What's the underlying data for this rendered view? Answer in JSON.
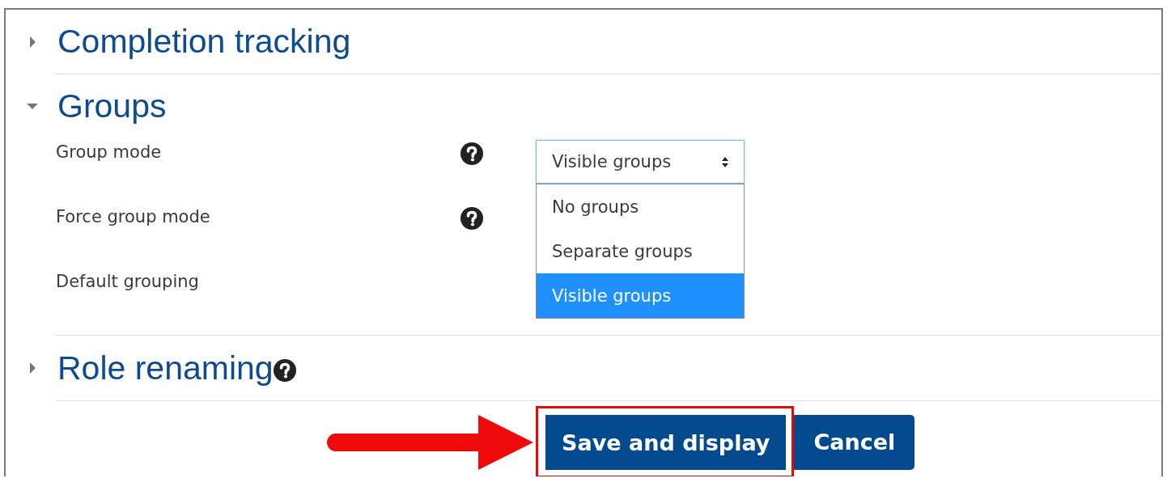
{
  "sections": [
    {
      "title": "Completion tracking",
      "expanded": false,
      "help": false
    },
    {
      "title": "Groups",
      "expanded": true,
      "help": false,
      "fields": [
        {
          "label": "Group mode",
          "help": true,
          "select": {
            "value": "Visible groups",
            "open": true,
            "options": [
              {
                "label": "No groups",
                "selected": false
              },
              {
                "label": "Separate groups",
                "selected": false
              },
              {
                "label": "Visible groups",
                "selected": true
              }
            ]
          }
        },
        {
          "label": "Force group mode",
          "help": true
        },
        {
          "label": "Default grouping",
          "help": false
        }
      ]
    },
    {
      "title": "Role renaming",
      "expanded": false,
      "help": true
    }
  ],
  "buttons": [
    {
      "label": "Save and display",
      "highlighted": true
    },
    {
      "label": "Cancel",
      "highlighted": false
    }
  ]
}
